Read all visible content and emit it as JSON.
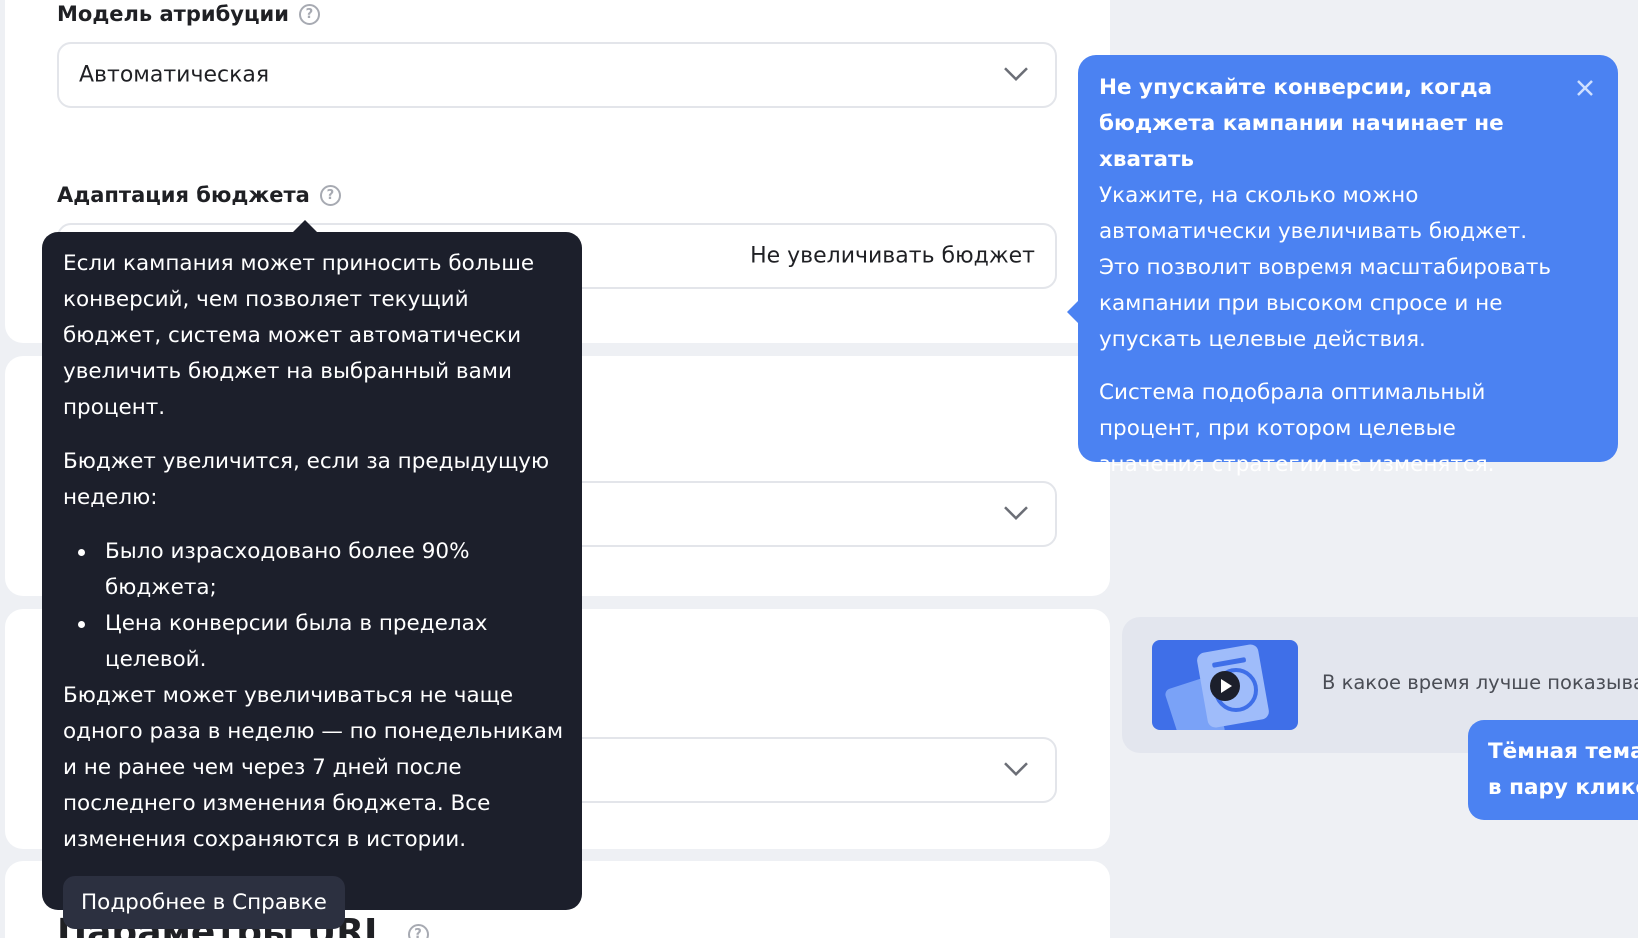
{
  "attribution": {
    "label": "Модель атрибуции",
    "value": "Автоматическая"
  },
  "budget_adaptation": {
    "label": "Адаптация бюджета",
    "value": "Не увеличивать бюджет"
  },
  "help_tooltip": {
    "p1": "Если кампания может приносить больше конверсий, чем позволяет текущий бюджет, система может автоматически увеличить бюджет на выбранный вами процент.",
    "p2": "Бюджет увеличится, если за предыдущую неделю:",
    "bullets": [
      "Было израсходовано более 90% бюджета;",
      "Цена конверсии была в пределах целевой."
    ],
    "p3": "Бюджет может увеличиваться не чаще одного раза в неделю — по понедельникам и не ранее чем через 7 дней после последнего изменения бюджета. Все изменения сохраняются в истории.",
    "link": "Подробнее в Справке"
  },
  "hint": {
    "title": "Не упускайте конверсии, когда бюджета кампании начинает не хватать",
    "p1": "Укажите, на сколько можно автоматически увеличивать бюджет. Это позволит вовремя масштабировать кампании при высоком спросе и не упускать целевые действия.",
    "p2": "Система подобрала оптимальный процент, при котором целевые значения стратегии не изменятся."
  },
  "promo": {
    "caption": "В какое время лучше показывать"
  },
  "dark_theme": {
    "line1": "Тёмная тема у",
    "line2": "в пару кликов"
  },
  "url_params": {
    "title": "Параметры URL"
  },
  "colors": {
    "tooltip_bg": "#1c1f2b",
    "hint_bg": "#4b82f2",
    "page_bg": "#eef0f4"
  }
}
